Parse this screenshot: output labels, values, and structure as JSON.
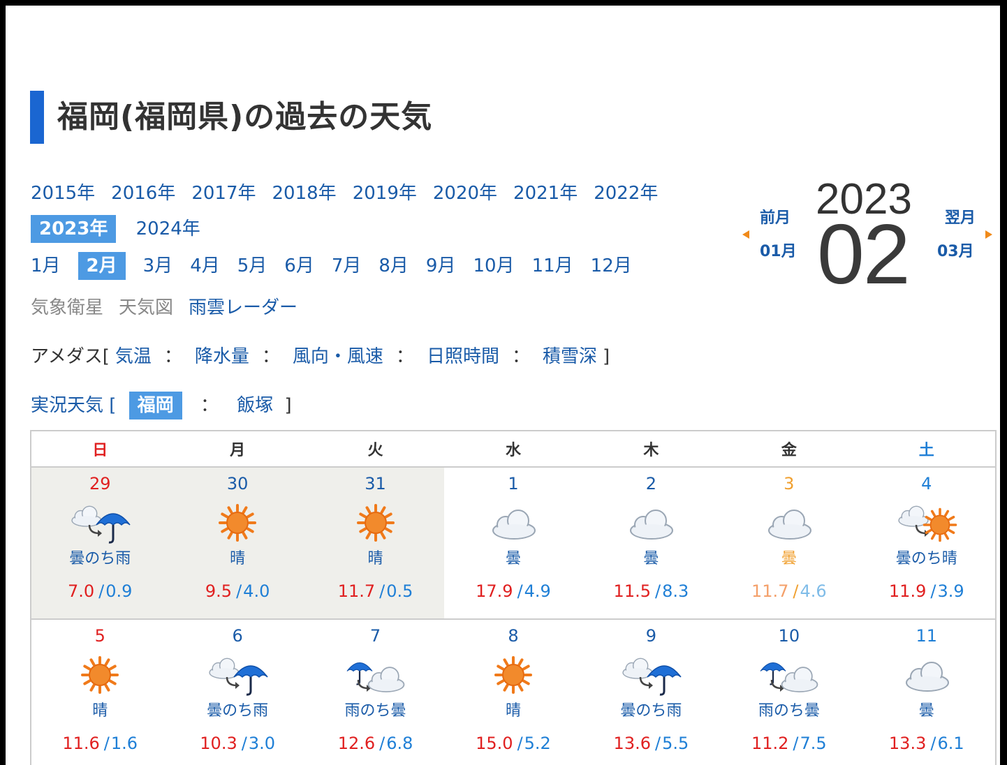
{
  "title": "福岡(福岡県)の過去の天気",
  "years_row1": [
    "2015年",
    "2016年",
    "2017年",
    "2018年",
    "2019年",
    "2020年",
    "2021年",
    "2022年"
  ],
  "years_selected": "2023年",
  "years_row2_other": "2024年",
  "months_before": [
    "1月"
  ],
  "month_selected": "2月",
  "months_after": [
    "3月",
    "4月",
    "5月",
    "6月",
    "7月",
    "8月",
    "9月",
    "10月",
    "11月",
    "12月"
  ],
  "maps": {
    "satellite": "気象衛星",
    "chart": "天気図",
    "radar": "雨雲レーダー"
  },
  "amedas": {
    "prefix": "アメダス[",
    "items": [
      "気温",
      "降水量",
      "風向・風速",
      "日照時間",
      "積雪深"
    ],
    "sep": "：",
    "suffix": "]"
  },
  "current": {
    "prefix": "実況天気 [",
    "selected": "福岡",
    "sep": "：",
    "other": "飯塚",
    "suffix": "]"
  },
  "nav": {
    "prev_label": "前月",
    "prev_month": "01月",
    "next_label": "翌月",
    "next_month": "03月",
    "year": "2023",
    "month": "02"
  },
  "weekdays": [
    "日",
    "月",
    "火",
    "水",
    "木",
    "金",
    "土"
  ],
  "colors": {
    "accent": "#1a66d1",
    "link": "#1a5ba8",
    "high": "#e02020",
    "low": "#1f7fd6",
    "holiday": "#f0a030"
  },
  "weeks": [
    [
      {
        "day": "29",
        "icon": "cloud-then-rain-icon",
        "text": "曇のち雨",
        "hi": "7.0",
        "lo": "0.9",
        "prev": true
      },
      {
        "day": "30",
        "icon": "sun-icon",
        "text": "晴",
        "hi": "9.5",
        "lo": "4.0",
        "prev": true
      },
      {
        "day": "31",
        "icon": "sun-icon",
        "text": "晴",
        "hi": "11.7",
        "lo": "0.5",
        "prev": true
      },
      {
        "day": "1",
        "icon": "cloud-icon",
        "text": "曇",
        "hi": "17.9",
        "lo": "4.9"
      },
      {
        "day": "2",
        "icon": "cloud-icon",
        "text": "曇",
        "hi": "11.5",
        "lo": "8.3"
      },
      {
        "day": "3",
        "icon": "cloud-icon",
        "text": "曇",
        "hi": "11.7",
        "lo": "4.6",
        "holiday": true
      },
      {
        "day": "4",
        "icon": "cloud-then-sun-icon",
        "text": "曇のち晴",
        "hi": "11.9",
        "lo": "3.9"
      }
    ],
    [
      {
        "day": "5",
        "icon": "sun-icon",
        "text": "晴",
        "hi": "11.6",
        "lo": "1.6"
      },
      {
        "day": "6",
        "icon": "cloud-then-rain-icon",
        "text": "曇のち雨",
        "hi": "10.3",
        "lo": "3.0"
      },
      {
        "day": "7",
        "icon": "rain-then-cloud-icon",
        "text": "雨のち曇",
        "hi": "12.6",
        "lo": "6.8"
      },
      {
        "day": "8",
        "icon": "sun-icon",
        "text": "晴",
        "hi": "15.0",
        "lo": "5.2"
      },
      {
        "day": "9",
        "icon": "cloud-then-rain-icon",
        "text": "曇のち雨",
        "hi": "13.6",
        "lo": "5.5"
      },
      {
        "day": "10",
        "icon": "rain-then-cloud-icon",
        "text": "雨のち曇",
        "hi": "11.2",
        "lo": "7.5"
      },
      {
        "day": "11",
        "icon": "cloud-icon",
        "text": "曇",
        "hi": "13.3",
        "lo": "6.1"
      }
    ]
  ]
}
